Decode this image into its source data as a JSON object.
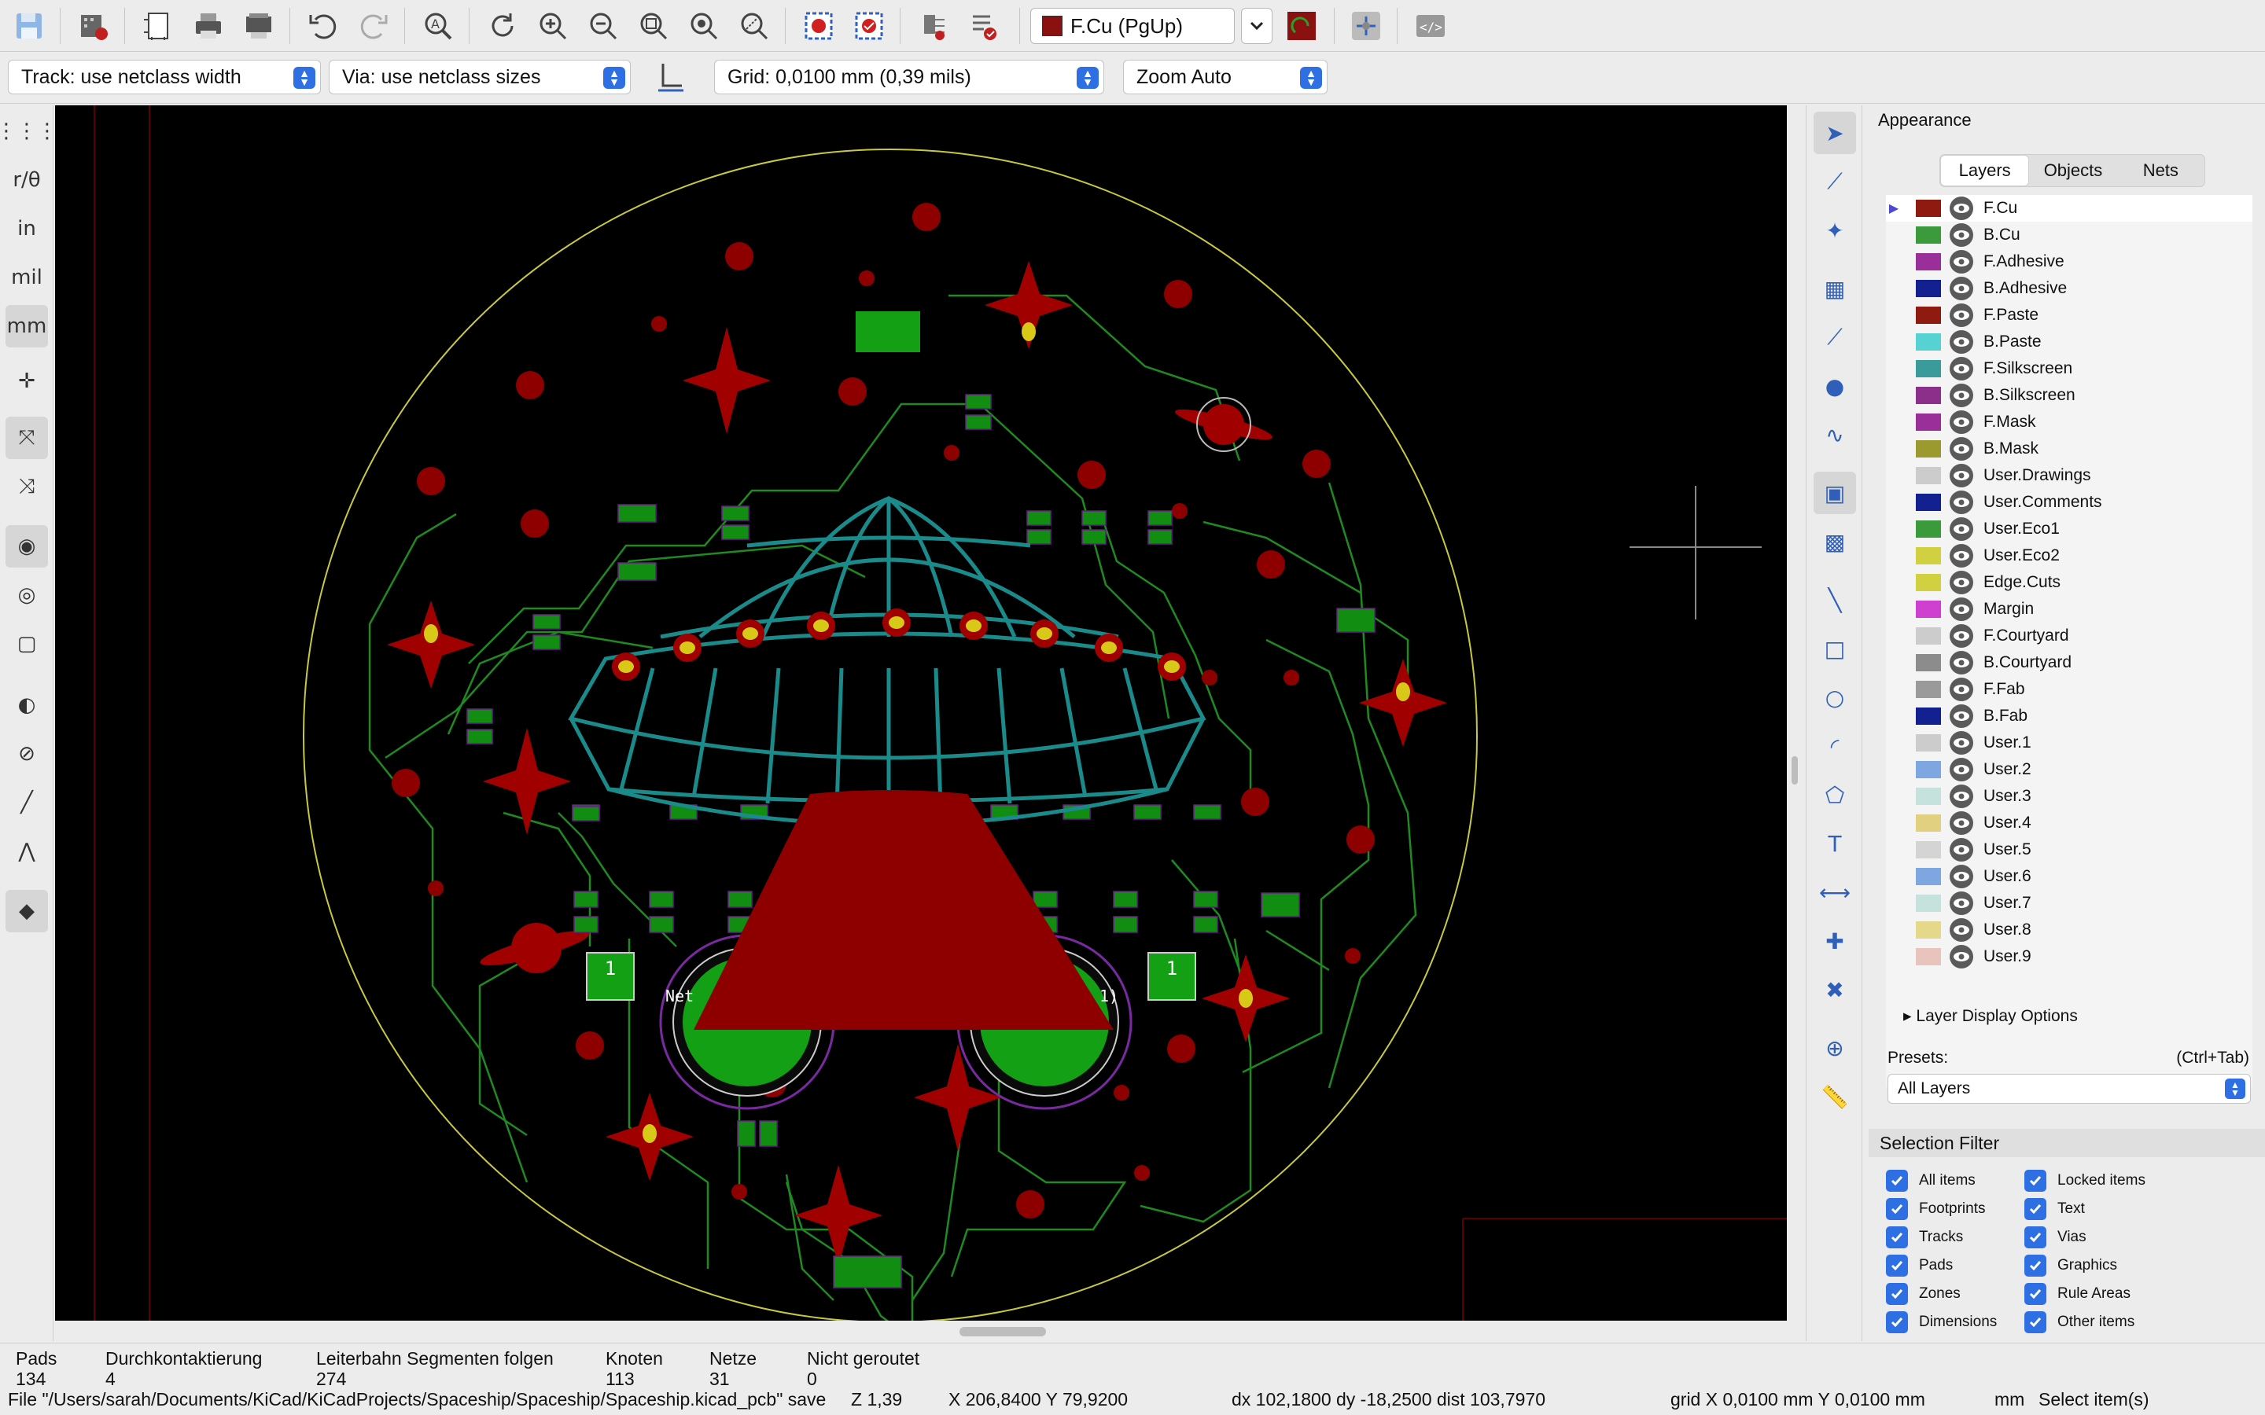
{
  "toolbar": {
    "icons": [
      "save-icon",
      "board-setup-icon",
      "page-settings-icon",
      "print-icon",
      "plot-icon",
      "undo-icon",
      "redo-icon",
      "find-icon",
      "refresh-icon",
      "zoom-in-icon",
      "zoom-out-icon",
      "zoom-fit-icon",
      "zoom-object-icon",
      "zoom-selection-icon",
      "drc-icon",
      "footprint-checker-icon",
      "netlist-icon",
      "update-pcb-icon",
      "scripting-icon"
    ],
    "active_layer": "F.Cu (PgUp)",
    "active_layer_color": "#8b1010"
  },
  "toolbar2": {
    "track": "Track: use netclass width",
    "via": "Via: use netclass sizes",
    "grid": "Grid: 0,0100 mm (0,39 mils)",
    "zoom": "Zoom Auto"
  },
  "left_tools": [
    {
      "name": "grid-icon",
      "glyph": "⋮⋮⋮",
      "active": false
    },
    {
      "name": "polar-coords-icon",
      "glyph": "r/θ",
      "active": false
    },
    {
      "name": "inch-units-icon",
      "glyph": "in",
      "active": false
    },
    {
      "name": "mil-units-icon",
      "glyph": "mil",
      "active": false
    },
    {
      "name": "mm-units-icon",
      "glyph": "mm",
      "active": true
    },
    {
      "name": "cursor-crosshair-icon",
      "glyph": "✛",
      "active": false
    },
    {
      "name": "ratsnest-icon",
      "glyph": "⤧",
      "active": true
    },
    {
      "name": "curved-ratsnest-icon",
      "glyph": "⤨",
      "active": false
    },
    {
      "name": "zone-fill-icon",
      "glyph": "◉",
      "active": true
    },
    {
      "name": "zone-unfill-icon",
      "glyph": "◎",
      "active": false
    },
    {
      "name": "zone-outline-icon",
      "glyph": "▢",
      "active": false
    },
    {
      "name": "pad-sketch-icon",
      "glyph": "◐",
      "active": false
    },
    {
      "name": "via-sketch-icon",
      "glyph": "⊘",
      "active": false
    },
    {
      "name": "track-sketch-icon",
      "glyph": "╱",
      "active": false
    },
    {
      "name": "graphics-sketch-icon",
      "glyph": "⋀",
      "active": false
    },
    {
      "name": "appearance-panel-icon",
      "glyph": "◆",
      "active": true
    }
  ],
  "right_tools": [
    {
      "name": "select-icon",
      "glyph": "➤",
      "active": true
    },
    {
      "name": "local-ratsnest-icon",
      "glyph": "⟋",
      "active": false
    },
    {
      "name": "highlight-net-icon",
      "glyph": "✦",
      "active": false
    },
    {
      "name": "add-footprint-icon",
      "glyph": "▦",
      "active": false
    },
    {
      "name": "route-track-icon",
      "glyph": "⟋",
      "active": false
    },
    {
      "name": "add-via-icon",
      "glyph": "●",
      "active": false
    },
    {
      "name": "tune-length-icon",
      "glyph": "∿",
      "active": false
    },
    {
      "name": "add-zone-icon",
      "glyph": "▣",
      "active": true
    },
    {
      "name": "add-rule-area-icon",
      "glyph": "▩",
      "active": false
    },
    {
      "name": "draw-line-icon",
      "glyph": "╲",
      "active": false
    },
    {
      "name": "draw-rectangle-icon",
      "glyph": "□",
      "active": false
    },
    {
      "name": "draw-circle-icon",
      "glyph": "○",
      "active": false
    },
    {
      "name": "draw-arc-icon",
      "glyph": "◜",
      "active": false
    },
    {
      "name": "draw-polygon-icon",
      "glyph": "⬠",
      "active": false
    },
    {
      "name": "add-text-icon",
      "glyph": "T",
      "active": false
    },
    {
      "name": "add-dimension-icon",
      "glyph": "⟷",
      "active": false
    },
    {
      "name": "place-anchor-icon",
      "glyph": "✚",
      "active": false
    },
    {
      "name": "delete-tool-icon",
      "glyph": "✖",
      "active": false
    },
    {
      "name": "grid-origin-icon",
      "glyph": "⊕",
      "active": false
    },
    {
      "name": "measure-icon",
      "glyph": "📏",
      "active": false
    }
  ],
  "appearance": {
    "title": "Appearance",
    "tabs": [
      "Layers",
      "Objects",
      "Nets"
    ],
    "active_tab": 0,
    "layers": [
      {
        "name": "F.Cu",
        "color": "#8e1a10",
        "selected": true
      },
      {
        "name": "B.Cu",
        "color": "#3b9a3b"
      },
      {
        "name": "F.Adhesive",
        "color": "#9a2f9a"
      },
      {
        "name": "B.Adhesive",
        "color": "#12218f"
      },
      {
        "name": "F.Paste",
        "color": "#8e1a10"
      },
      {
        "name": "B.Paste",
        "color": "#56d2d2"
      },
      {
        "name": "F.Silkscreen",
        "color": "#3b9a9a"
      },
      {
        "name": "B.Silkscreen",
        "color": "#8b2f8b"
      },
      {
        "name": "F.Mask",
        "color": "#9a2f9a"
      },
      {
        "name": "B.Mask",
        "color": "#9a9a2f"
      },
      {
        "name": "User.Drawings",
        "color": "#cccccc"
      },
      {
        "name": "User.Comments",
        "color": "#12218f"
      },
      {
        "name": "User.Eco1",
        "color": "#3b9a3b"
      },
      {
        "name": "User.Eco2",
        "color": "#d0d040"
      },
      {
        "name": "Edge.Cuts",
        "color": "#d0d040"
      },
      {
        "name": "Margin",
        "color": "#d040d0"
      },
      {
        "name": "F.Courtyard",
        "color": "#cccccc"
      },
      {
        "name": "B.Courtyard",
        "color": "#8c8c8c"
      },
      {
        "name": "F.Fab",
        "color": "#9a9a9a"
      },
      {
        "name": "B.Fab",
        "color": "#12218f"
      },
      {
        "name": "User.1",
        "color": "#cccccc"
      },
      {
        "name": "User.2",
        "color": "#7ea6e0"
      },
      {
        "name": "User.3",
        "color": "#c6e2dc"
      },
      {
        "name": "User.4",
        "color": "#e0d080"
      },
      {
        "name": "User.5",
        "color": "#d4d4d4"
      },
      {
        "name": "User.6",
        "color": "#7ea6e0"
      },
      {
        "name": "User.7",
        "color": "#c6e2dc"
      },
      {
        "name": "User.8",
        "color": "#e6d88a"
      },
      {
        "name": "User.9",
        "color": "#e8c4bc"
      }
    ],
    "layer_display_options": "Layer Display Options",
    "presets_label": "Presets:",
    "presets_shortcut": "(Ctrl+Tab)",
    "preset_value": "All Layers"
  },
  "selection_filter": {
    "title": "Selection Filter",
    "items": [
      "All items",
      "Locked items",
      "Footprints",
      "Text",
      "Tracks",
      "Vias",
      "Pads",
      "Graphics",
      "Zones",
      "Rule Areas",
      "Dimensions",
      "Other items"
    ]
  },
  "board": {
    "pad_label": "1",
    "net_left": "Net",
    "net_right": "1)"
  },
  "status": {
    "pads_label": "Pads",
    "pads": "134",
    "vias_label": "Durchkontaktierung",
    "vias": "4",
    "segments_label": "Leiterbahn Segmenten folgen",
    "segments": "274",
    "nodes_label": "Knoten",
    "nodes": "113",
    "nets_label": "Netze",
    "nets": "31",
    "unrouted_label": "Nicht geroutet",
    "unrouted": "0",
    "file": "File \"/Users/sarah/Documents/KiCad/KiCadProjects/Spaceship/Spaceship/Spaceship.kicad_pcb\" save",
    "zoom": "Z 1,39",
    "coords": "X 206,8400  Y 79,9200",
    "delta": "dx 102,1800  dy -18,2500  dist 103,7970",
    "grid": "grid X 0,0100 mm  Y 0,0100 mm",
    "units": "mm",
    "mode": "Select item(s)"
  }
}
